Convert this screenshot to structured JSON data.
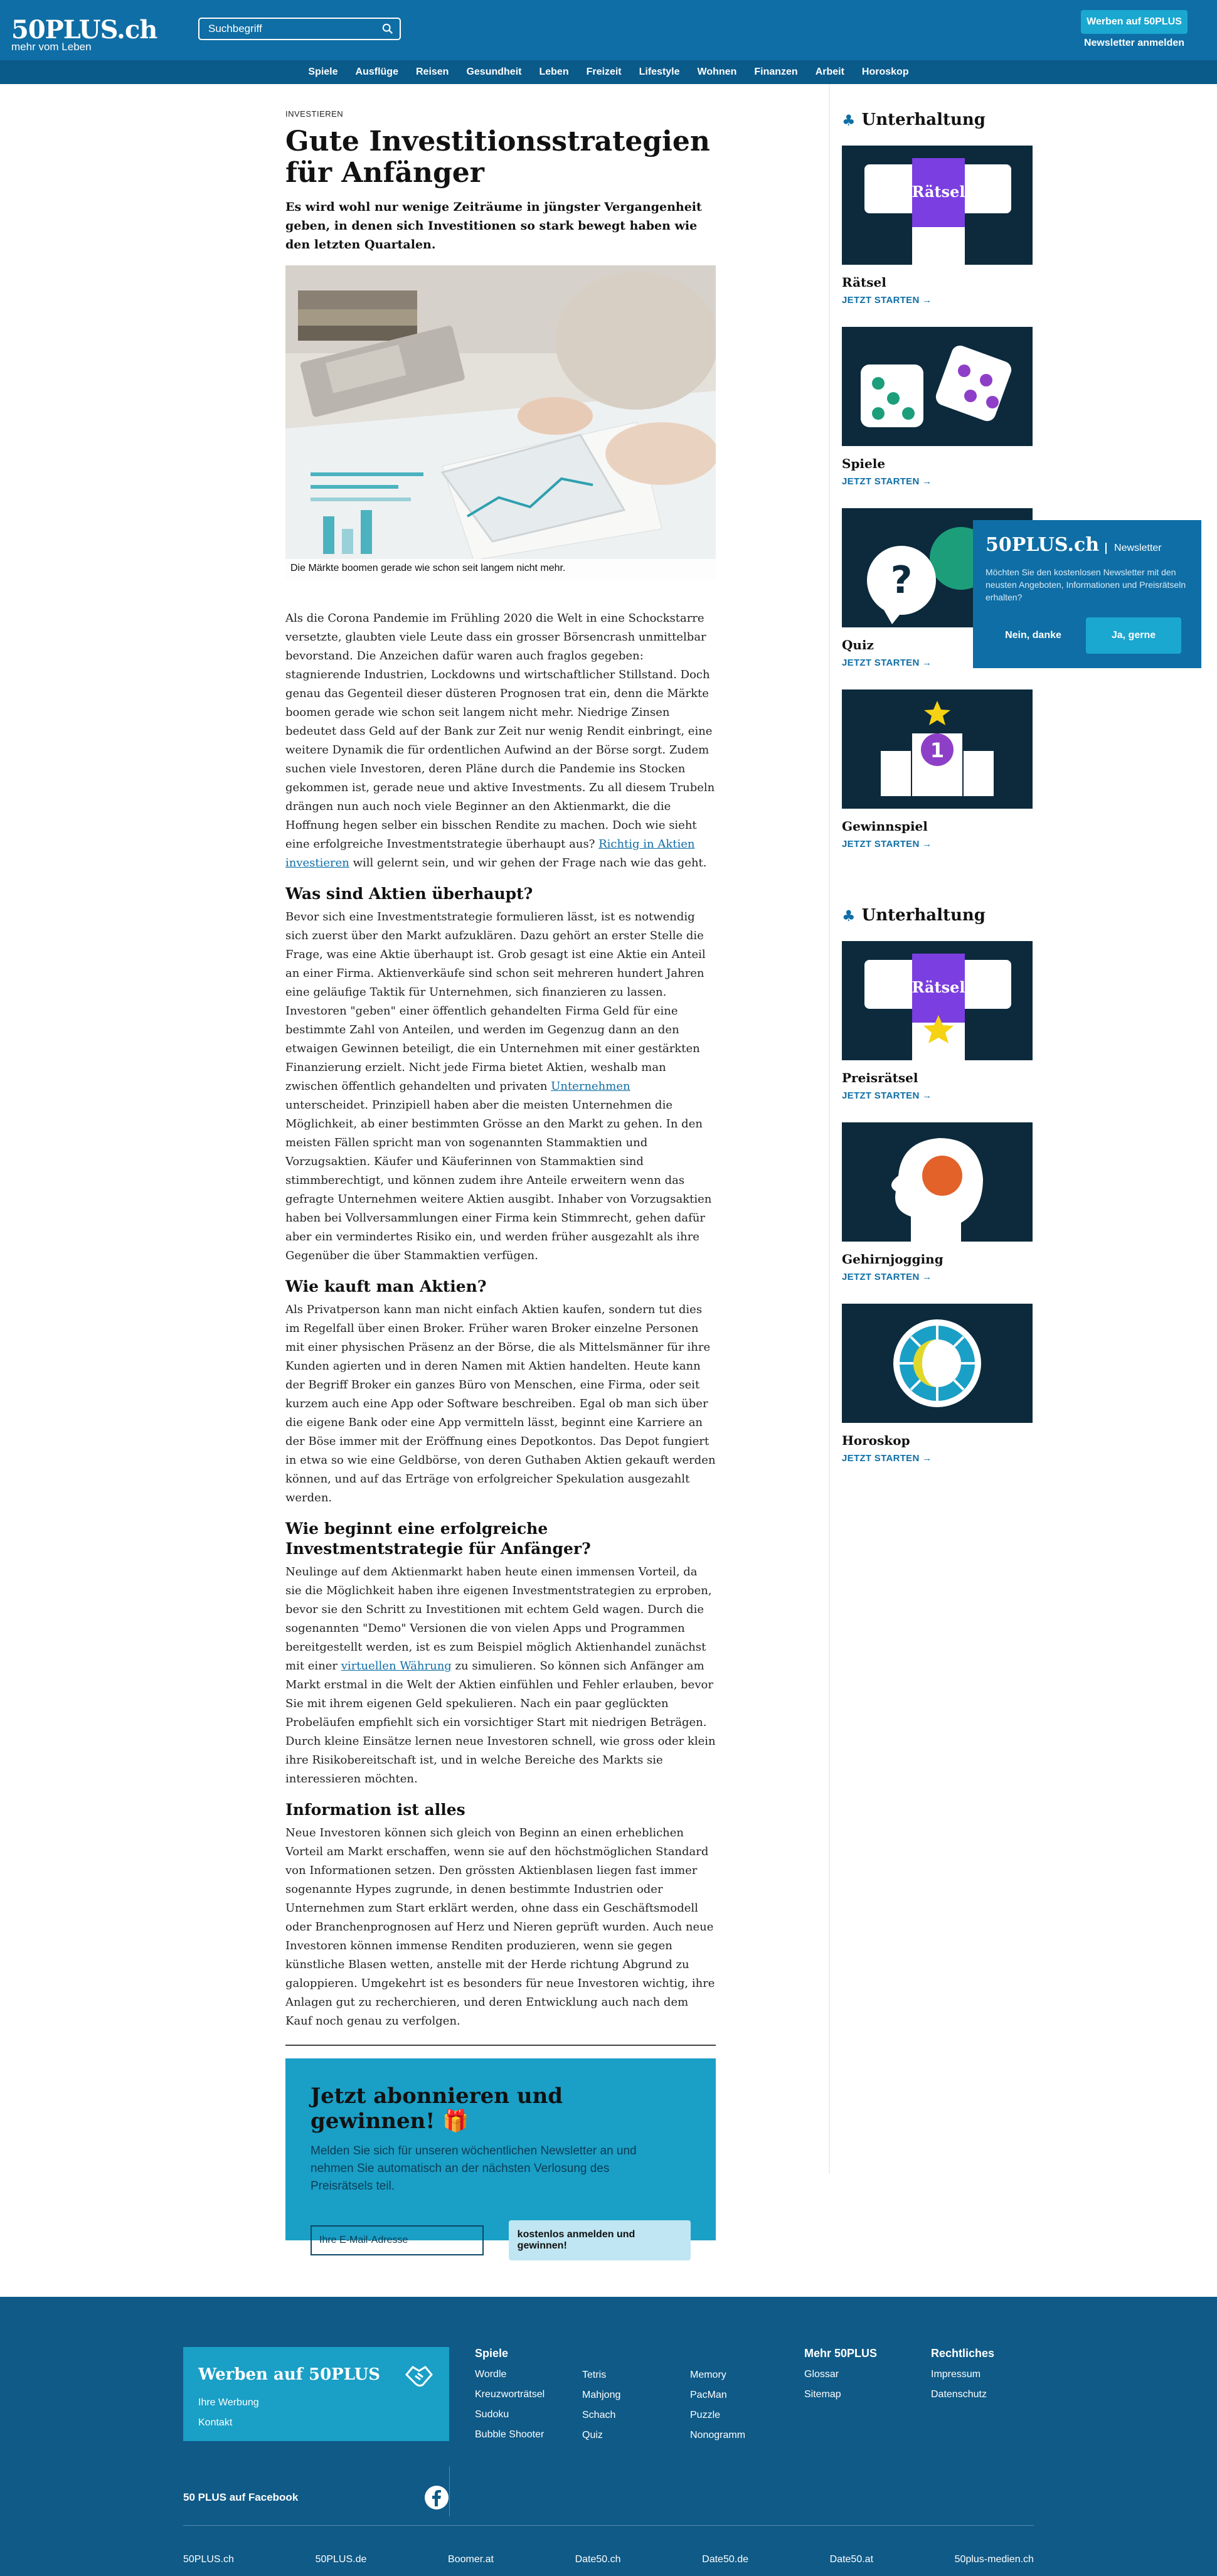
{
  "header": {
    "logo": "50PLUS.ch",
    "tagline": "mehr vom Leben",
    "search_placeholder": "Suchbegriff",
    "werben_button": "Werben auf 50PLUS",
    "newsletter_link": "Newsletter anmelden"
  },
  "nav": [
    "Spiele",
    "Ausflüge",
    "Reisen",
    "Gesundheit",
    "Leben",
    "Freizeit",
    "Lifestyle",
    "Wohnen",
    "Finanzen",
    "Arbeit",
    "Horoskop"
  ],
  "article": {
    "category": "Investieren",
    "title": "Gute Investitionsstrategien für Anfänger",
    "lead": "Es wird wohl nur wenige Zeiträume in jüngster Vergangenheit geben, in denen sich Investitionen so stark bewegt haben wie den letzten Quartalen.",
    "image_caption": "Die Märkte boomen gerade wie schon seit langem nicht mehr.",
    "p1_a": "Als die Corona Pandemie im Frühling 2020 die Welt in eine Schockstarre versetzte, glaubten viele Leute dass ein grosser Börsencrash unmittelbar bevorstand. Die Anzeichen dafür waren auch fraglos gegeben: stagnierende Industrien, Lockdowns und wirtschaftlicher Stillstand. Doch genau das Gegenteil dieser düsteren Prognosen trat ein, denn die Märkte boomen gerade wie schon seit langem nicht mehr. Niedrige Zinsen bedeutet dass Geld auf der Bank zur Zeit nur wenig Rendit einbringt, eine weitere Dynamik die für ordentlichen Aufwind an der Börse sorgt. Zudem suchen viele Investoren, deren Pläne durch die Pandemie ins Stocken gekommen ist, gerade neue und aktive Investments. Zu all diesem Trubeln drängen nun auch noch viele Beginner an den Aktienmarkt, die die Hoffnung hegen selber ein bisschen Rendite zu machen. Doch wie sieht eine erfolgreiche Investmentstrategie überhaupt aus? ",
    "p1_link": "Richtig in Aktien investieren",
    "p1_b": " will gelernt sein, und wir gehen der Frage nach wie das geht.",
    "h2_1": "Was sind Aktien überhaupt?",
    "p2_a": "Bevor sich eine Investmentstrategie formulieren lässt, ist es notwendig sich zuerst über den Markt aufzuklären. Dazu gehört an erster Stelle die Frage, was eine Aktie überhaupt ist. Grob gesagt ist eine Aktie ein Anteil an einer Firma. Aktienverkäufe sind schon seit mehreren hundert Jahren eine geläufige Taktik für Unternehmen, sich finanzieren zu lassen. Investoren \"geben\" einer öffentlich gehandelten Firma Geld für eine bestimmte Zahl von Anteilen, und werden im Gegenzug dann an den etwaigen Gewinnen beteiligt, die ein Unternehmen mit einer gestärkten Finanzierung erzielt. Nicht jede Firma bietet Aktien, weshalb man zwischen öffentlich gehandelten und privaten ",
    "p2_link": "Unternehmen",
    "p2_b": " unterscheidet. Prinzipiell haben aber die meisten Unternehmen die Möglichkeit, ab einer bestimmten Grösse an den Markt zu gehen. In den meisten Fällen spricht man von sogenannten Stammaktien und Vorzugsaktien. Käufer und Käuferinnen von Stammaktien sind stimmberechtigt, und können zudem ihre Anteile erweitern wenn das gefragte Unternehmen weitere Aktien ausgibt. Inhaber von Vorzugsaktien haben bei Vollversammlungen einer Firma kein Stimmrecht, gehen dafür aber ein vermindertes Risiko ein, und werden früher ausgezahlt als ihre Gegenüber die über Stammaktien verfügen.",
    "h2_2": "Wie kauft man Aktien?",
    "p3": "Als Privatperson kann man nicht einfach Aktien kaufen, sondern tut dies im Regelfall über einen Broker. Früher waren Broker einzelne Personen mit einer physischen Präsenz an der Börse, die als Mittelsmänner für ihre Kunden agierten und in deren Namen mit Aktien handelten. Heute kann der Begriff Broker ein ganzes Büro von Menschen, eine Firma, oder seit kurzem auch eine App oder Software beschreiben. Egal ob man sich über die eigene Bank oder eine App vermitteln lässt, beginnt eine Karriere an der Böse immer mit der Eröffnung eines Depotkontos. Das Depot fungiert in etwa so wie eine Geldbörse, von deren Guthaben Aktien gekauft werden können, und auf das Erträge von erfolgreicher Spekulation ausgezahlt werden.",
    "h2_3": "Wie beginnt eine erfolgreiche Investmentstrategie für Anfänger?",
    "p4_a": "Neulinge auf dem Aktienmarkt haben heute einen immensen Vorteil, da sie die Möglichkeit haben ihre eigenen Investmentstrategien zu erproben, bevor sie den Schritt zu Investitionen mit echtem Geld wagen. Durch die sogenannten \"Demo\" Versionen die von vielen Apps und Programmen bereitgestellt werden, ist es zum Beispiel möglich Aktienhandel zunächst mit einer ",
    "p4_link": "virtuellen Währung",
    "p4_b": " zu simulieren. So können sich Anfänger am Markt erstmal in die Welt der Aktien einfühlen und Fehler erlauben, bevor Sie mit ihrem eigenen Geld spekulieren. Nach ein paar geglückten Probeläufen empfiehlt sich ein vorsichtiger Start mit niedrigen Beträgen. Durch kleine Einsätze lernen neue Investoren schnell, wie gross oder klein ihre Risikobereitschaft ist, und in welche Bereiche des Markts sie interessieren möchten.",
    "h2_4": "Information ist alles",
    "p5": "Neue Investoren können sich gleich von Beginn an einen erheblichen Vorteil am Markt erschaffen, wenn sie auf den höchstmöglichen Standard von Informationen setzen. Den grössten Aktienblasen liegen fast immer sogenannte Hypes zugrunde, in denen bestimmte Industrien oder Unternehmen zum Start erklärt werden, ohne dass ein Geschäftsmodell oder Branchenprognosen auf Herz und Nieren geprüft wurden. Auch neue Investoren können immense Renditen produzieren, wenn sie gegen künstliche Blasen wetten, anstelle mit der Herde richtung Abgrund zu galoppieren. Umgekehrt ist es besonders für neue Investoren wichtig, ihre Anlagen gut zu recherchieren, und deren Entwicklung auch nach dem Kauf noch genau zu verfolgen."
  },
  "subscribe": {
    "title": "Jetzt abonnieren und gewinnen!",
    "text": "Melden Sie sich für unseren wöchentlichen Newsletter an und nehmen Sie automatisch an der nächsten Verlosung des Preisrätsels teil.",
    "email_placeholder": "Ihre E-Mail-Adresse",
    "button": "kostenlos anmelden und gewinnen!"
  },
  "sidebar": {
    "section1_title": "Unterhaltung",
    "section2_title": "Unterhaltung",
    "cta": "JETZT STARTEN",
    "cards1": [
      {
        "title": "Rätsel",
        "img_label": "Rätsel"
      },
      {
        "title": "Spiele"
      },
      {
        "title": "Quiz"
      },
      {
        "title": "Gewinnspiel",
        "img_label": "1"
      }
    ],
    "cards2": [
      {
        "title": "Preisrätsel",
        "img_label": "Rätsel"
      },
      {
        "title": "Gehirnjogging"
      },
      {
        "title": "Horoskop"
      }
    ]
  },
  "popup": {
    "logo": "50PLUS.ch",
    "tag": "Newsletter",
    "text": "Möchten Sie den kostenlosen Newsletter mit den neusten Angeboten, Informationen und Preisrätseln erhalten?",
    "no": "Nein, danke",
    "yes": "Ja, gerne"
  },
  "footer": {
    "ad_title": "Werben auf 50PLUS",
    "ad_links": [
      "Ihre Werbung",
      "Kontakt"
    ],
    "spiele_head": "Spiele",
    "spiele_col1": [
      "Wordle",
      "Kreuzworträtsel",
      "Sudoku",
      "Bubble Shooter"
    ],
    "spiele_col2": [
      "Tetris",
      "Mahjong",
      "Schach",
      "Quiz"
    ],
    "spiele_col3": [
      "Memory",
      "PacMan",
      "Puzzle",
      "Nonogramm"
    ],
    "mehr_head": "Mehr 50PLUS",
    "mehr_links": [
      "Glossar",
      "Sitemap"
    ],
    "recht_head": "Rechtliches",
    "recht_links": [
      "Impressum",
      "Datenschutz"
    ],
    "facebook": "50 PLUS auf Facebook",
    "sites": [
      "50PLUS.ch",
      "50PLUS.de",
      "Boomer.at",
      "Date50.ch",
      "Date50.de",
      "Date50.at",
      "50plus-medien.ch"
    ]
  },
  "colors": {
    "brand": "#0f6ea5",
    "accent": "#1aa7d0",
    "dark_nav": "#0a5a8a",
    "card_bg": "#0c2a3c"
  }
}
